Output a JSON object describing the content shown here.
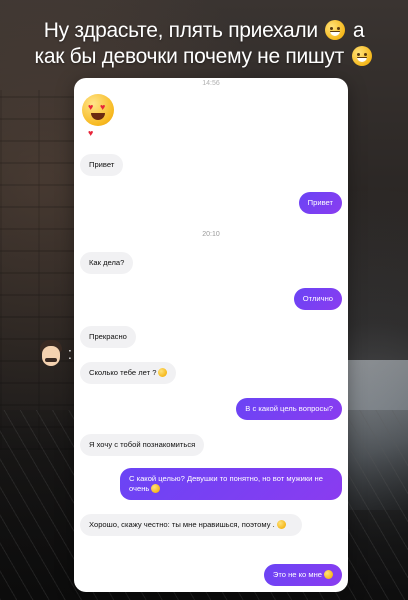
{
  "caption": {
    "line1": "Ну здрасьте, плять приехали",
    "line1_tail": "а",
    "line2": "как бы девочки почему не пишут",
    "emoji_1": "rofl-face",
    "emoji_2": "grinning-face"
  },
  "chat": {
    "top_time": "14:56",
    "timestamp": "20:10",
    "header_emoji": "heart-eyes-face",
    "messages": [
      {
        "dir": "in",
        "text": "Привет"
      },
      {
        "dir": "out",
        "text": "Привет"
      },
      {
        "dir": "in",
        "text": "Как дела?"
      },
      {
        "dir": "out",
        "text": "Отлично"
      },
      {
        "dir": "in",
        "text": "Прекрасно"
      },
      {
        "dir": "in",
        "text": "Сколько тебе лет ?"
      },
      {
        "dir": "out",
        "text": "В с какой цель вопросы?"
      },
      {
        "dir": "in",
        "text": "Я хочу с тобой познакомиться"
      },
      {
        "dir": "out",
        "text": "С какой целью? Девушки то понятно, но вот мужики не очень"
      },
      {
        "dir": "in",
        "text": "Хорошо, скажу честно: ты мне нравишься, поэтому ."
      },
      {
        "dir": "out",
        "text": "Это не ко мне"
      }
    ]
  },
  "sticker": {
    "name": "man-mustache-emoji",
    "dots": "⁚"
  },
  "colors": {
    "bubble_out": "#7b3ff2",
    "bubble_in": "#f1f1f3",
    "text_white": "#ffffff"
  }
}
